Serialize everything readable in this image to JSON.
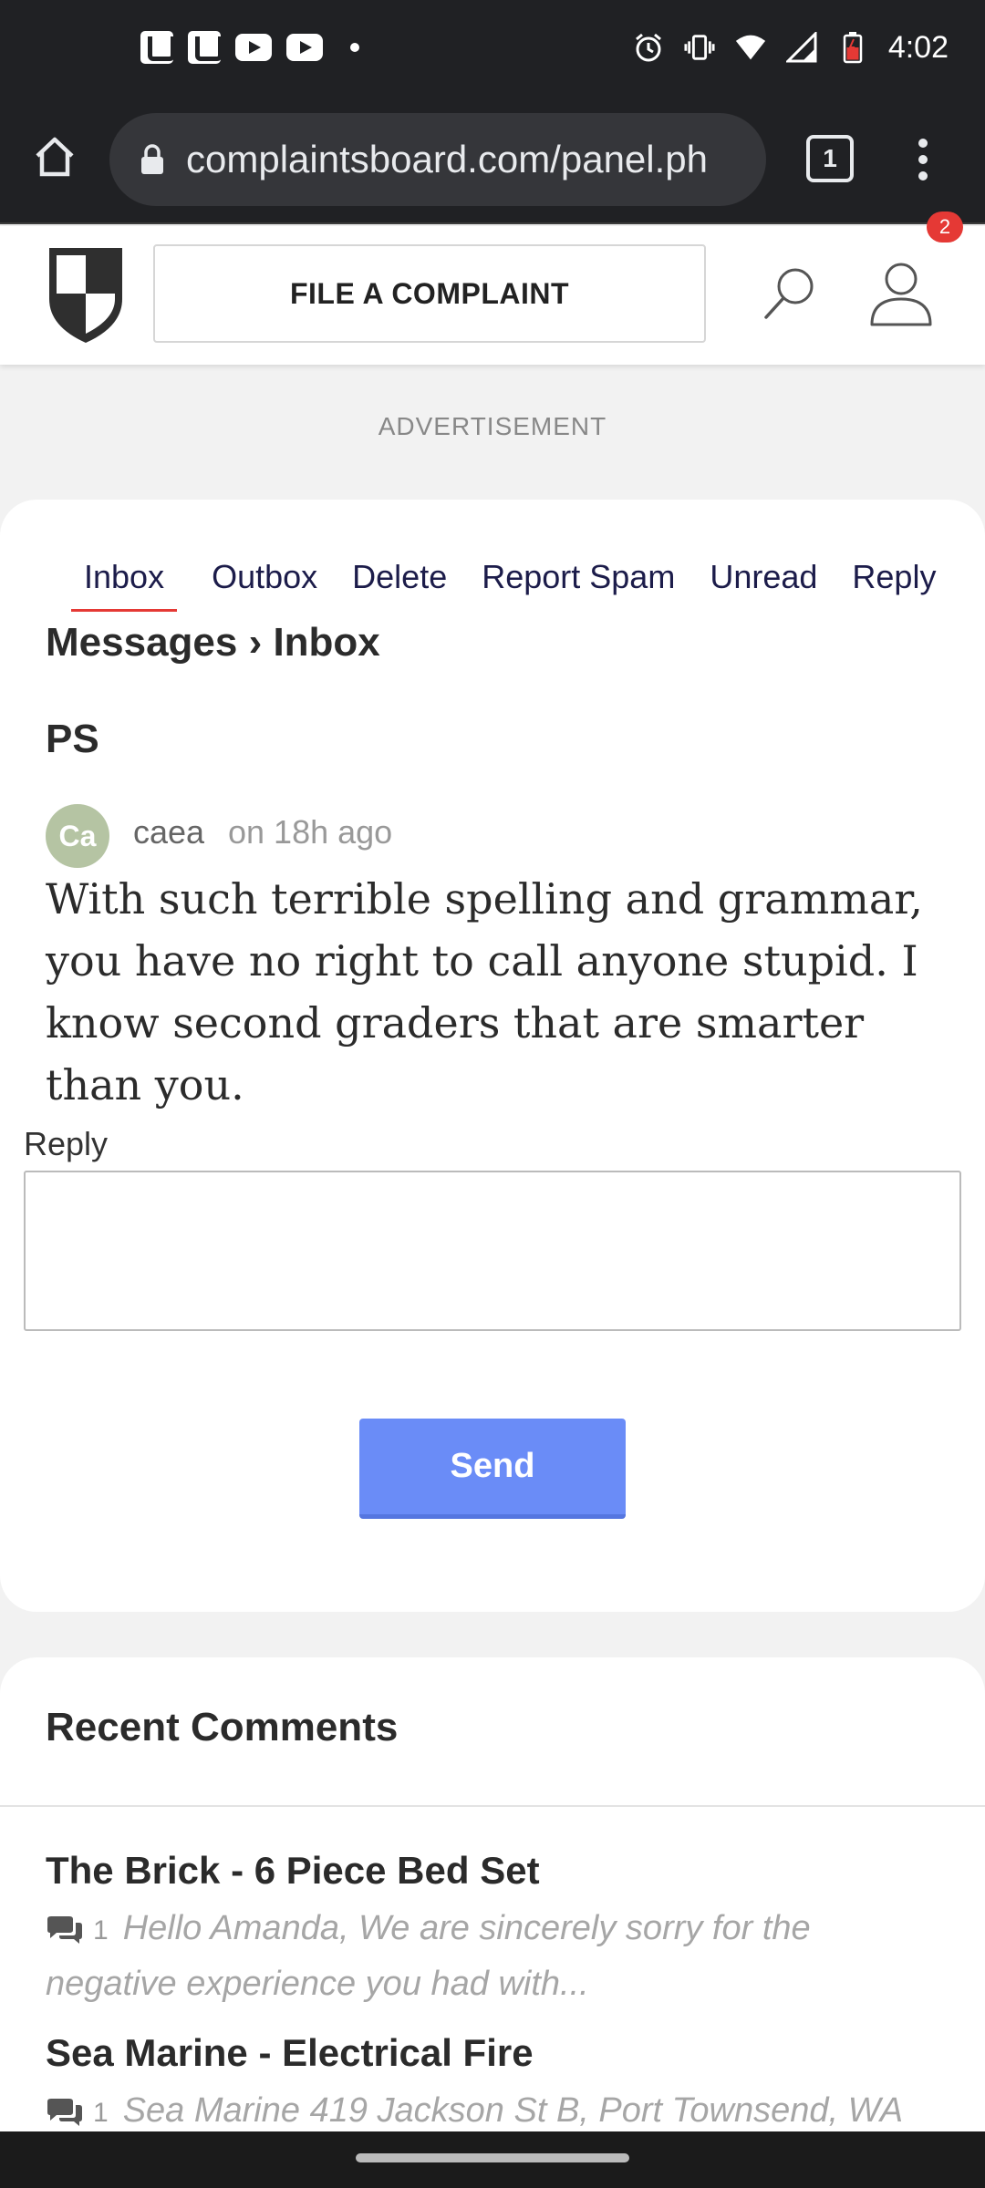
{
  "status_bar": {
    "time": "4:02",
    "left_icons": [
      "u-app-icon",
      "u-app-icon",
      "youtube-icon",
      "youtube-icon",
      "dot-icon"
    ],
    "right_icons": [
      "alarm-icon",
      "vibrate-icon",
      "wifi-icon",
      "signal-icon",
      "battery-icon"
    ]
  },
  "browser": {
    "url": "complaintsboard.com/panel.ph",
    "tab_count": "1"
  },
  "header": {
    "file_button": "FILE A COMPLAINT",
    "notification_count": "2"
  },
  "advertisement_label": "ADVERTISEMENT",
  "message_tabs": [
    {
      "label": "Inbox",
      "active": true
    },
    {
      "label": "Outbox"
    },
    {
      "label": "Delete"
    },
    {
      "label": "Report Spam"
    },
    {
      "label": "Unread"
    },
    {
      "label": "Reply"
    }
  ],
  "breadcrumb": "Messages › Inbox",
  "message": {
    "subject": "PS",
    "avatar_initials": "Ca",
    "sender": "caea",
    "time": "on 18h ago",
    "body": "With such terrible spelling and grammar, you have no right to call anyone stupid. I know second graders that are smarter than you."
  },
  "reply": {
    "label": "Reply",
    "placeholder": "",
    "send_label": "Send"
  },
  "recent_comments": {
    "title": "Recent Comments",
    "items": [
      {
        "title": "The Brick - 6 Piece Bed Set",
        "count": "1",
        "excerpt": "Hello Amanda, We are sincerely sorry for the negative experience you had with..."
      },
      {
        "title": "Sea Marine - Electrical Fire",
        "count": "1",
        "excerpt": "Sea Marine 419 Jackson St B, Port Townsend, WA"
      }
    ]
  },
  "colors": {
    "accent_red": "#e53935",
    "send_button": "#6a8cf7",
    "avatar_bg": "#b5c4a3"
  }
}
